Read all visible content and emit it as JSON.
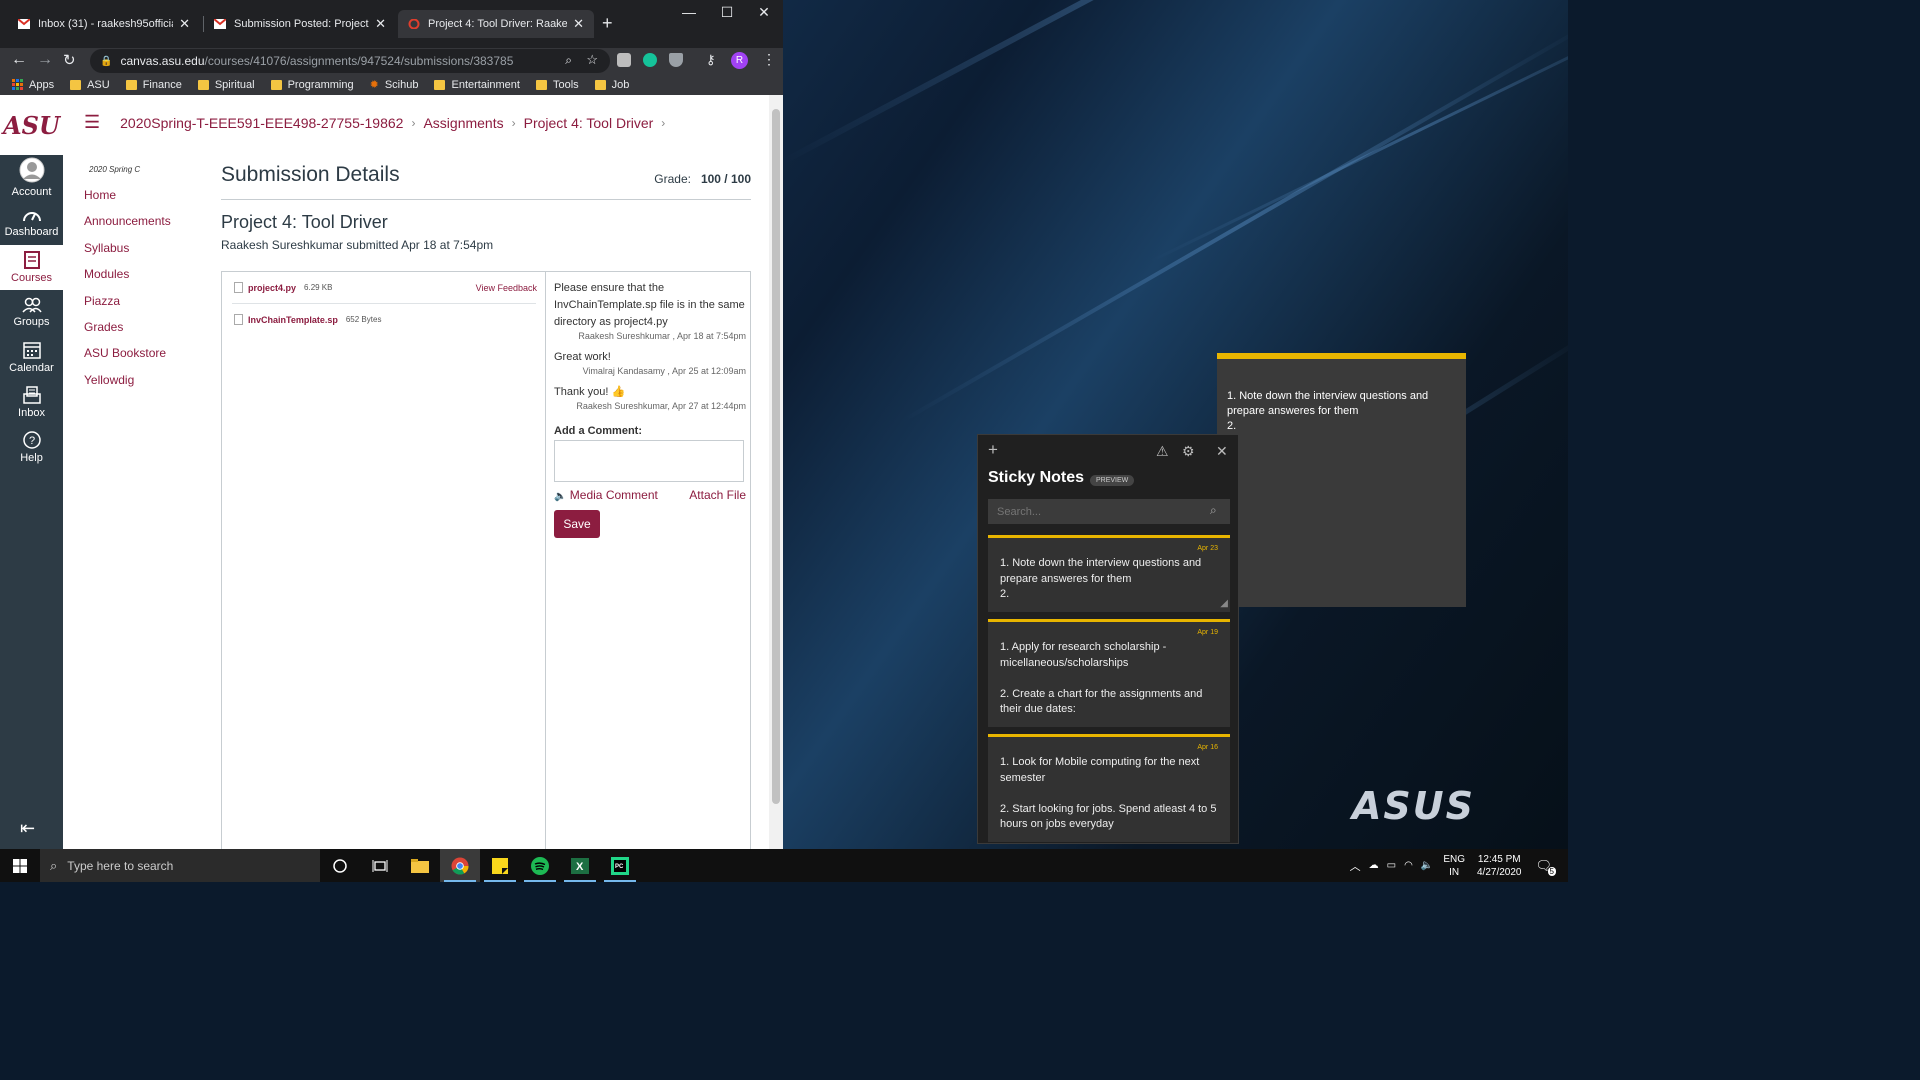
{
  "browser": {
    "tabs": [
      {
        "title": "Inbox (31) - raakesh95official@g",
        "icon": "gmail-icon"
      },
      {
        "title": "Submission Posted: Project 4: Too",
        "icon": "gmail-icon"
      },
      {
        "title": "Project 4: Tool Driver: Raakesh Su",
        "icon": "canvas-icon"
      }
    ],
    "url_host": "canvas.asu.edu",
    "url_path": "/courses/41076/assignments/947524/submissions/383785",
    "profile_initial": "R",
    "bookmarks": [
      {
        "label": "Apps",
        "icon": "apps-grid-icon"
      },
      {
        "label": "ASU",
        "icon": "folder-icon"
      },
      {
        "label": "Finance",
        "icon": "folder-icon"
      },
      {
        "label": "Spiritual",
        "icon": "folder-icon"
      },
      {
        "label": "Programming",
        "icon": "folder-icon"
      },
      {
        "label": "Scihub",
        "icon": "scihub-icon"
      },
      {
        "label": "Entertainment",
        "icon": "folder-icon"
      },
      {
        "label": "Tools",
        "icon": "folder-icon"
      },
      {
        "label": "Job",
        "icon": "folder-icon"
      }
    ]
  },
  "canvas": {
    "logo": "ASU",
    "global_nav": [
      {
        "label": "Account",
        "icon": "account-icon"
      },
      {
        "label": "Dashboard",
        "icon": "dashboard-icon"
      },
      {
        "label": "Courses",
        "icon": "courses-icon"
      },
      {
        "label": "Groups",
        "icon": "groups-icon"
      },
      {
        "label": "Calendar",
        "icon": "calendar-icon"
      },
      {
        "label": "Inbox",
        "icon": "inbox-icon"
      },
      {
        "label": "Help",
        "icon": "help-icon"
      }
    ],
    "breadcrumbs": [
      "2020Spring-T-EEE591-EEE498-27755-19862",
      "Assignments",
      "Project 4: Tool Driver"
    ],
    "term": "2020 Spring C",
    "course_nav": [
      "Home",
      "Announcements",
      "Syllabus",
      "Modules",
      "Piazza",
      "Grades",
      "ASU Bookstore",
      "Yellowdig"
    ],
    "page_title": "Submission Details",
    "grade_label": "Grade:",
    "grade_value": "100 / 100",
    "assignment_title": "Project 4: Tool Driver",
    "submitted_line": "Raakesh Sureshkumar submitted Apr 18 at 7:54pm",
    "files": [
      {
        "name": "project4.py",
        "size": "6.29 KB",
        "action": "View Feedback"
      },
      {
        "name": "InvChainTemplate.sp",
        "size": "652 Bytes",
        "action": ""
      }
    ],
    "comments": [
      {
        "text": "Please ensure that the InvChainTemplate.sp file is in the same directory as project4.py",
        "meta": "Raakesh Sureshkumar , Apr 18 at 7:54pm"
      },
      {
        "text": "Great work!",
        "meta": "Vimalraj Kandasamy , Apr 25 at 12:09am"
      },
      {
        "text": "Thank you! 👍",
        "meta": "Raakesh Sureshkumar, Apr 27 at 12:44pm"
      }
    ],
    "add_comment_label": "Add a Comment:",
    "media_comment": "Media Comment",
    "attach_file": "Attach File",
    "save": "Save"
  },
  "sticky_notes": {
    "title": "Sticky Notes",
    "badge": "PREVIEW",
    "search_placeholder": "Search...",
    "open_note": "1. Note down the interview questions and prepare answeres for them\n2.",
    "notes": [
      {
        "date": "Apr 23",
        "text": "1. Note down the interview questions and prepare answeres for them\n2."
      },
      {
        "date": "Apr 19",
        "text": "1. Apply for research scholarship - micellaneous/scholarships\n\n2. Create a chart for the assignments and their due dates:"
      },
      {
        "date": "Apr 16",
        "text": "1. Look for Mobile computing for the next semester\n\n2. Start looking for jobs. Spend atleast 4 to 5 hours on jobs everyday"
      }
    ]
  },
  "desktop": {
    "brand": "ASUS"
  },
  "taskbar": {
    "search_placeholder": "Type here to search",
    "lang": "ENG",
    "region": "IN",
    "time": "12:45 PM",
    "date": "4/27/2020",
    "notifications": "5"
  },
  "colors": {
    "asu_maroon": "#8c1d40",
    "sticky_yellow": "#e8b500",
    "canvas_nav": "#2d3b45"
  }
}
